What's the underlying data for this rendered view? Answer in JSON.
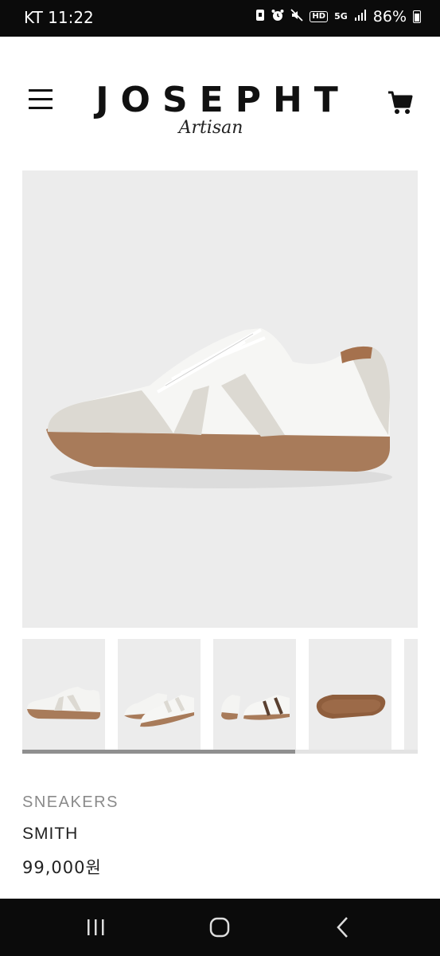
{
  "status_bar": {
    "carrier_time": "KT 11:22",
    "network": "5G",
    "hd_badge": "HD",
    "battery": "86%",
    "icons": [
      "box-icon",
      "alarm-icon",
      "mute-icon",
      "hd-icon",
      "5g-icon",
      "signal-icon",
      "battery-icon"
    ]
  },
  "header": {
    "brand": "JOSEPHT",
    "brand_sub": "Artisan",
    "icons": [
      "menu-icon",
      "cart-icon"
    ]
  },
  "product": {
    "category": "SNEAKERS",
    "name": "SMITH",
    "price": "99,000원",
    "gallery_progress": 0.69
  },
  "nav_bar": {
    "icons": [
      "recent-apps-icon",
      "home-icon",
      "back-icon"
    ]
  }
}
